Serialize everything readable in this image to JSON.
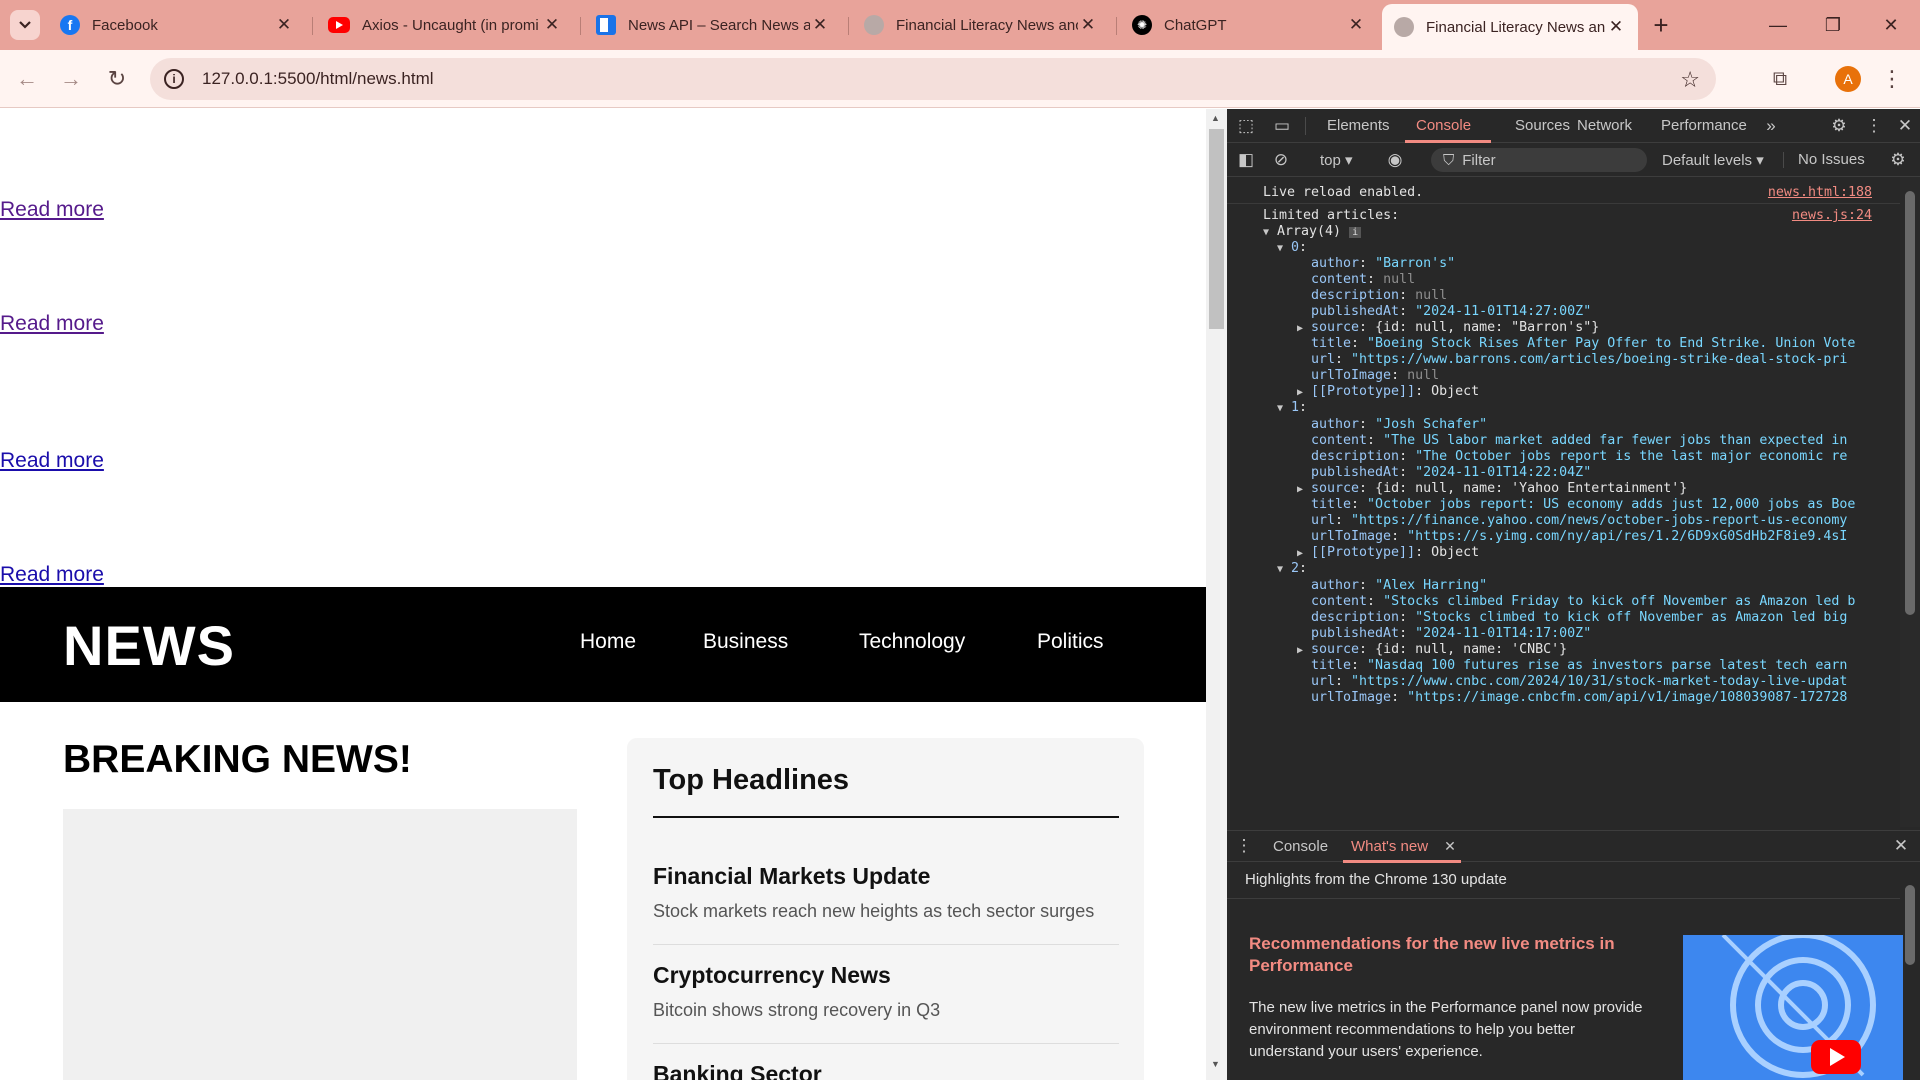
{
  "browser": {
    "tabs": [
      {
        "title": "Facebook",
        "icon": "facebook-icon",
        "color": "#1877f2"
      },
      {
        "title": "Axios - Uncaught (in promi",
        "icon": "youtube-icon",
        "color": "#ff0000"
      },
      {
        "title": "News API – Search News ar",
        "icon": "newsapi-icon",
        "color": "#1a73e8"
      },
      {
        "title": "Financial Literacy News anc",
        "icon": "globe-icon",
        "color": "#8a7d7b"
      },
      {
        "title": "ChatGPT",
        "icon": "chatgpt-icon",
        "color": "#000000"
      },
      {
        "title": "Financial Literacy News an",
        "icon": "globe-icon",
        "color": "#8a7d7b",
        "active": true
      }
    ],
    "url": "127.0.0.1:5500/html/news.html",
    "avatar_letter": "A",
    "accent": "#e8a39a"
  },
  "page": {
    "read_more_links": [
      "Read more",
      "Read more",
      "Read more",
      "Read more"
    ],
    "header": {
      "brand": "NEWS",
      "nav": [
        "Home",
        "Business",
        "Technology",
        "Politics"
      ]
    },
    "breaking_title": "BREAKING NEWS!",
    "top_headlines": {
      "title": "Top Headlines",
      "items": [
        {
          "title": "Financial Markets Update",
          "desc": "Stock markets reach new heights as tech sector surges"
        },
        {
          "title": "Cryptocurrency News",
          "desc": "Bitcoin shows strong recovery in Q3"
        },
        {
          "title": "Banking Sector",
          "desc": ""
        }
      ]
    }
  },
  "devtools": {
    "tabs": [
      "Elements",
      "Console",
      "Sources",
      "Network",
      "Performance"
    ],
    "active_tab": "Console",
    "context": "top",
    "filter_placeholder": "Filter",
    "levels": "Default levels",
    "issues": "No Issues",
    "console": {
      "live_reload": "Live reload enabled.",
      "live_reload_src": "news.html:188",
      "limited_label": "Limited articles:",
      "limited_src": "news.js:24",
      "array_label": "Array(4)",
      "articles": [
        {
          "index": "0",
          "author": "\"Barron's\"",
          "content": "null",
          "description": "null",
          "publishedAt": "\"2024-11-01T14:27:00Z\"",
          "source": "{id: null, name: \"Barron's\"}",
          "title": "\"Boeing Stock Rises After Pay Offer to End Strike. Union Vote",
          "url": "\"https://www.barrons.com/articles/boeing-strike-deal-stock-pri",
          "urlToImage": "null"
        },
        {
          "index": "1",
          "author": "\"Josh Schafer\"",
          "content": "\"The US labor market added far fewer jobs than expected in",
          "description": "\"The October jobs report is the last major economic re",
          "publishedAt": "\"2024-11-01T14:22:04Z\"",
          "source": "{id: null, name: 'Yahoo Entertainment'}",
          "title": "\"October jobs report: US economy adds just 12,000 jobs as Boe",
          "url": "\"https://finance.yahoo.com/news/october-jobs-report-us-economy",
          "urlToImage": "\"https://s.yimg.com/ny/api/res/1.2/6D9xG0SdHb2F8ie9.4sI"
        },
        {
          "index": "2",
          "author": "\"Alex Harring\"",
          "content": "\"Stocks climbed Friday to kick off November as Amazon led b",
          "description": "\"Stocks climbed to kick off November as Amazon led big",
          "publishedAt": "\"2024-11-01T14:17:00Z\"",
          "source": "{id: null, name: 'CNBC'}",
          "title": "\"Nasdaq 100 futures rise as investors parse latest tech earn",
          "url": "\"https://www.cnbc.com/2024/10/31/stock-market-today-live-updat",
          "urlToImage": "\"https://image.cnbcfm.com/api/v1/image/108039087-172728"
        }
      ],
      "prototype_label": "[[Prototype]]",
      "prototype_value": "Object"
    },
    "drawer": {
      "tabs": [
        "Console",
        "What's new"
      ],
      "active": "What's new",
      "headline": "Highlights from the Chrome 130 update",
      "card_title": "Recommendations for the new live metrics in Performance",
      "card_body": "The new live metrics in the Performance panel now provide environment recommendations to help you better understand your users' experience."
    }
  }
}
